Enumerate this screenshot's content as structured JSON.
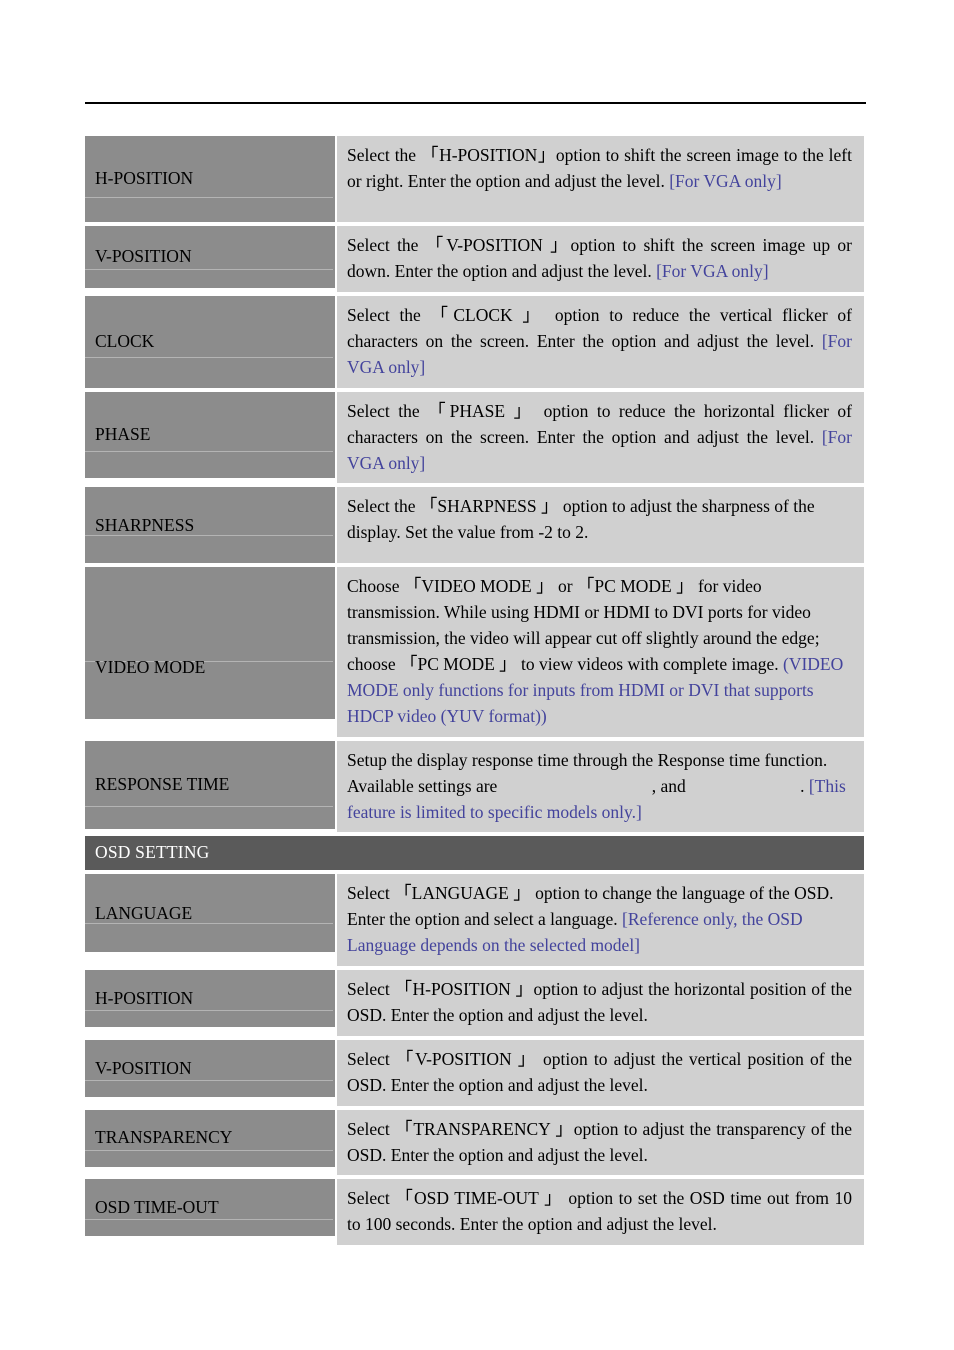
{
  "document": {
    "type": "monitor-osd-settings-manual-page",
    "blue_note_color": "#43439c",
    "label_cell_color": "#8c8c8c",
    "desc_cell_color": "#d0d0d0",
    "section_header_color": "#5a5a5a"
  },
  "rows": [
    {
      "label": "H-POSITION",
      "desc_prefix": "Select the ",
      "desc_open": "「",
      "desc_option": "H-POSITION",
      "desc_close": "」",
      "desc_body": "option to shift the screen image to the left or right. Enter the option and adjust the level. ",
      "desc_note": "[For VGA only]"
    },
    {
      "label": "V-POSITION",
      "desc_prefix": "Select the  ",
      "desc_open": "「",
      "desc_option": "V-POSITION ",
      "desc_close": "」",
      "desc_body": "option to shift the screen image up or down. Enter the option and adjust the level. ",
      "desc_note": "[For VGA only]"
    },
    {
      "label": "CLOCK",
      "desc_prefix": "Select the  ",
      "desc_open": "「",
      "desc_option": "CLOCK ",
      "desc_close": "」",
      "desc_body": " option to reduce the vertical flicker of characters on the screen. Enter the option and adjust the level. ",
      "desc_note": "[For VGA only]"
    },
    {
      "label": "PHASE",
      "desc_prefix": "Select the ",
      "desc_open": "「",
      "desc_option": "PHASE ",
      "desc_close": "」",
      "desc_body": " option to reduce the horizontal flicker of characters on the screen. Enter the option and adjust the level. ",
      "desc_note": "[For VGA only]"
    },
    {
      "label": "SHARPNESS",
      "desc_prefix": "Select the ",
      "desc_open": "「",
      "desc_option": "SHARPNESS ",
      "desc_close": "」",
      "desc_body": " option to adjust the sharpness of the display. Set the value from -2 to 2.",
      "desc_note": ""
    },
    {
      "label": "LANGUAGE",
      "desc_prefix": "Select  ",
      "desc_open": "「",
      "desc_option": "LANGUAGE ",
      "desc_close": "」",
      "desc_body": "  option to change the language of the OSD. Enter the option and select a language. ",
      "desc_note": "[Reference only, the OSD Language depends on the selected model]"
    },
    {
      "label": "H-POSITION",
      "desc_prefix": "Select ",
      "desc_open": "「",
      "desc_option": "H-POSITION ",
      "desc_close": "」",
      "desc_body": "option to adjust the horizontal position of the OSD. Enter the option and adjust the level.",
      "desc_note": ""
    },
    {
      "label": "V-POSITION",
      "desc_prefix": "Select  ",
      "desc_open": "「",
      "desc_option": "V-POSITION ",
      "desc_close": "」",
      "desc_body": " option to adjust the vertical position of the OSD. Enter the option and adjust the level.",
      "desc_note": ""
    },
    {
      "label": "TRANSPARENCY",
      "desc_prefix": "Select ",
      "desc_open": "「",
      "desc_option": "TRANSPARENCY ",
      "desc_close": "」",
      "desc_body": "option to adjust the transparency of the OSD. Enter the option and adjust the level.",
      "desc_note": ""
    },
    {
      "label": "OSD TIME-OUT",
      "desc_prefix": "Select  ",
      "desc_open": "「",
      "desc_option": "OSD TIME-OUT ",
      "desc_close": "」",
      "desc_body": " option to set the OSD time out from 10 to 100 seconds. Enter the option and adjust the level.",
      "desc_note": ""
    }
  ],
  "video_mode": {
    "label": "VIDEO MODE",
    "part1": "Choose ",
    "open1": "「",
    "option1": "VIDEO MODE ",
    "close1": "」",
    "part2": " or  ",
    "open2": "「",
    "option2": "PC MODE ",
    "close2": "」",
    "part3": " for video transmission. While using HDMI or HDMI to DVI ports for video transmission, the video will appear cut off slightly around the edge; choose ",
    "open3": "「",
    "option3": "PC MODE ",
    "close3": "」",
    "part4": " to view videos with complete image. ",
    "note": "(VIDEO MODE only functions for inputs from HDMI or DVI that supports HDCP video (YUV format))"
  },
  "response_time": {
    "label": "RESPONSE TIME",
    "part1": "Setup the display response time through the Response time function. Available settings are ",
    "blank1": "",
    "part2": ", and ",
    "blank2": "",
    "part3": ". ",
    "note": "[This feature is limited to specific models only.]"
  },
  "section_header": {
    "label": "OSD SETTING"
  }
}
